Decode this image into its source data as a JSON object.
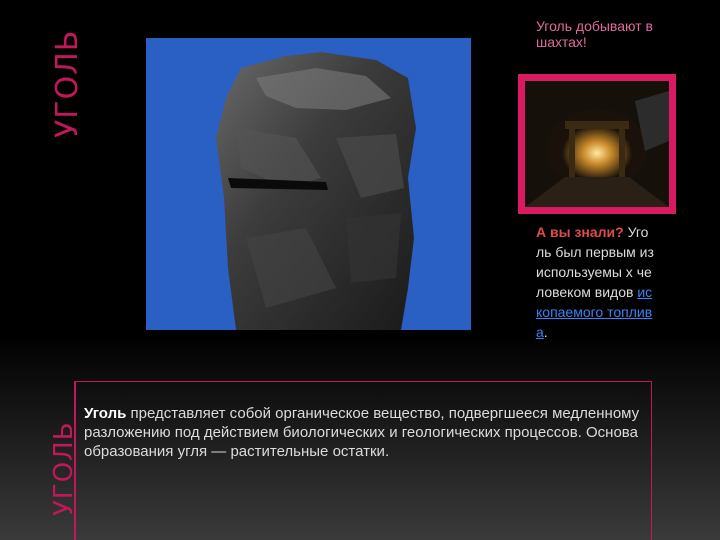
{
  "slide": {
    "vertical_title_top": "УГОЛЬ",
    "vertical_title_bottom": "УГОЛЬ",
    "caption": "Уголь добывают в шахтах!",
    "fact": {
      "question": "А вы знали?",
      "text_before": "Уголь был первым из используемы х человеком видов ",
      "link_text": "ископаемого топлива",
      "text_after": "."
    },
    "description": {
      "bold": "Уголь",
      "text": " представляет собой органическое вещество, подвергшееся медленному разложению под действием биологических и геологических процессов. Основа образования угля — растительные остатки."
    }
  },
  "colors": {
    "accent": "#c2185b",
    "caption": "#e06aa0",
    "photo_background": "#2a5fc4",
    "link": "#3b82f6"
  }
}
